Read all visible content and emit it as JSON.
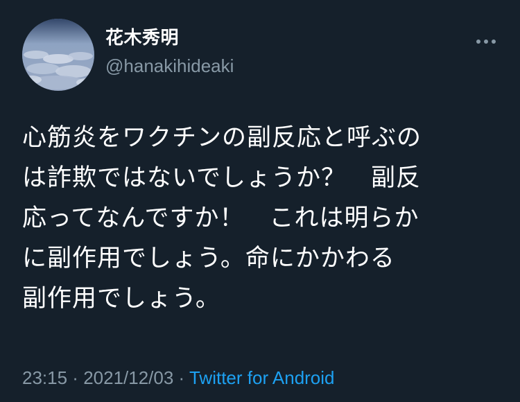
{
  "user": {
    "display_name": "花木秀明",
    "handle": "@hanakihideaki",
    "avatar_icon": "cloudscape-avatar"
  },
  "more_icon": "more-horizontal-icon",
  "tweet": {
    "lines": [
      "心筋炎をワクチンの副反応と呼ぶの",
      "は詐欺ではないでしょうか？　副反",
      "応ってなんですか！　これは明らか",
      "に副作用でしょう。命にかかわる",
      "副作用でしょう。"
    ]
  },
  "meta": {
    "time": "23:15",
    "separator1": " · ",
    "date": "2021/12/03",
    "separator2": " · ",
    "source": "Twitter for Android"
  },
  "colors": {
    "background": "#15202b",
    "text": "#ffffff",
    "secondary": "#8899a6",
    "link": "#1da1f2"
  }
}
